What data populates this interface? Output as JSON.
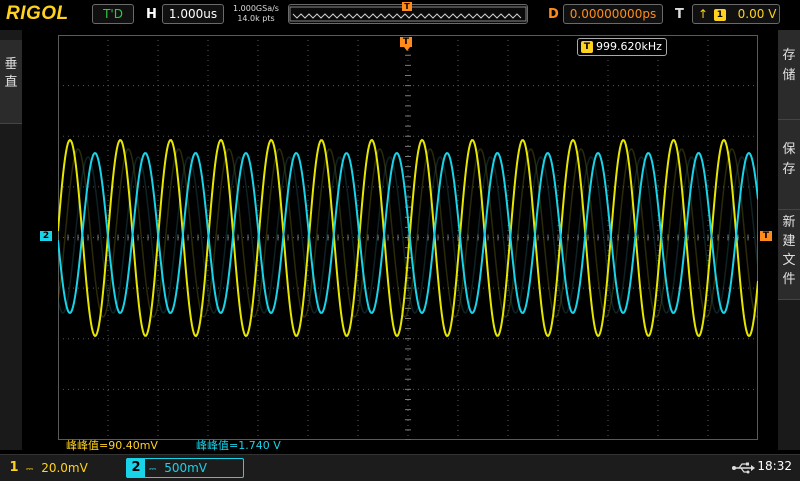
{
  "brand": "RIGOL",
  "header": {
    "run_status": "T'D",
    "timebase_label": "H",
    "timebase": "1.000us",
    "sample_rate": "1.000GSa/s",
    "memory_depth": "14.0k pts",
    "delay_label": "D",
    "delay": "0.00000000ps",
    "trigger_label": "T",
    "trigger_source": "1",
    "trigger_level": "0.00 V"
  },
  "left_menu": {
    "tabs": [
      "垂直"
    ]
  },
  "right_menu": {
    "tabs": [
      "存储",
      "保存",
      "新建文件"
    ]
  },
  "frequency_counter": {
    "icon": "T",
    "value": "999.620kHz"
  },
  "markers": {
    "trigger_top": "T",
    "ch2_offset": "2",
    "trigger_level_right": "T"
  },
  "measurements": [
    {
      "text": "峰峰值=90.40mV",
      "color": "#ffd21e"
    },
    {
      "text": "峰峰值=1.740 V",
      "color": "#19d3e8"
    }
  ],
  "channels": [
    {
      "number": "1",
      "coupling_icon": "dc-coupling-icon",
      "scale": "20.0mV",
      "color": "#ffd21e"
    },
    {
      "number": "2",
      "coupling_icon": "dc-coupling-icon",
      "scale": "500mV",
      "color": "#19d3e8"
    }
  ],
  "status": {
    "usb_icon": "usb-icon",
    "clock": "18:32"
  },
  "colors": {
    "ch1": "#e6e600",
    "ch2": "#19d3e8",
    "accent": "#ff8c1a"
  }
}
